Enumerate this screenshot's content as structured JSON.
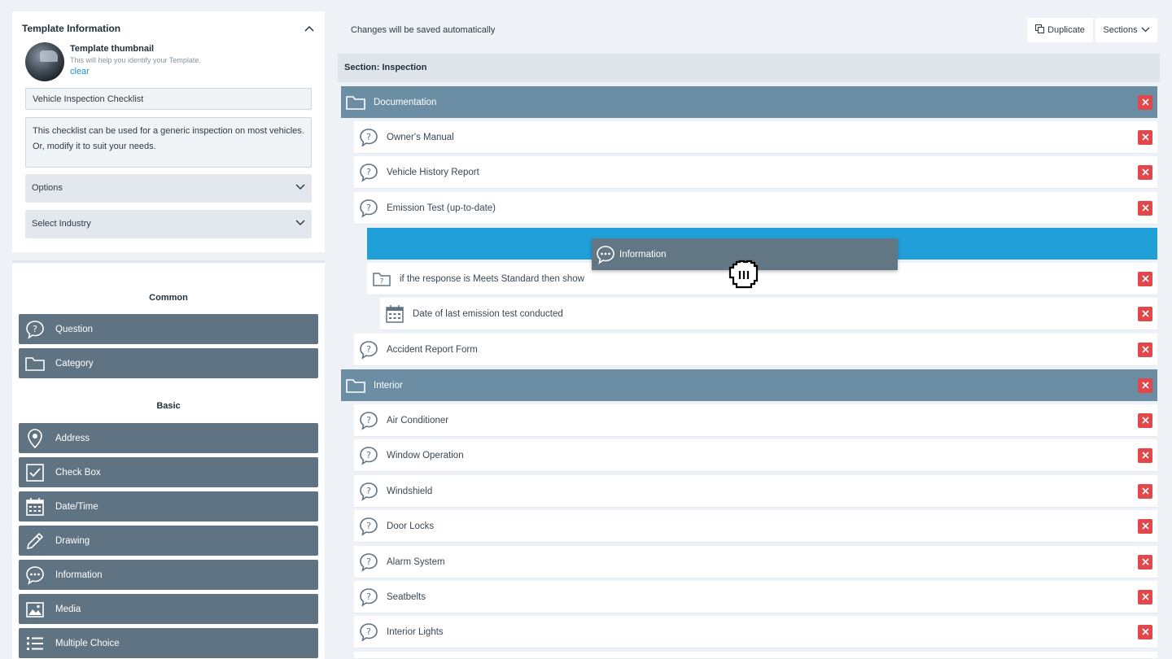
{
  "template_info": {
    "title": "Template Information",
    "thumbnail_title": "Template thumbnail",
    "thumbnail_sub": "This will help you identify your Template.",
    "clear_label": "clear",
    "name_value": "Vehicle Inspection Checklist",
    "description_value": "This checklist can be used for a generic inspection on most vehicles. Or, modify it to suit your needs.",
    "options_label": "Options",
    "industry_label": "Select Industry"
  },
  "palette": {
    "common_title": "Common",
    "common": [
      {
        "label": "Question",
        "icon": "question-bubble-icon"
      },
      {
        "label": "Category",
        "icon": "folder-icon"
      }
    ],
    "basic_title": "Basic",
    "basic": [
      {
        "label": "Address",
        "icon": "location-pin-icon"
      },
      {
        "label": "Check Box",
        "icon": "checkbox-icon"
      },
      {
        "label": "Date/Time",
        "icon": "calendar-icon"
      },
      {
        "label": "Drawing",
        "icon": "pencil-icon"
      },
      {
        "label": "Information",
        "icon": "chat-dots-icon"
      },
      {
        "label": "Media",
        "icon": "image-icon"
      },
      {
        "label": "Multiple Choice",
        "icon": "list-icon"
      }
    ]
  },
  "toolbar": {
    "autosave_text": "Changes will be saved automatically",
    "duplicate_label": "Duplicate",
    "sections_label": "Sections"
  },
  "section": {
    "title": "Section: Inspection",
    "documentation_label": "Documentation",
    "doc_items": [
      "Owner's Manual",
      "Vehicle History Report",
      "Emission Test (up-to-date)"
    ],
    "condition_label": "if the response is Meets Standard then show",
    "date_item": "Date of last emission test conducted",
    "accident_item": "Accident Report Form",
    "interior_label": "Interior",
    "interior_items": [
      "Air Conditioner",
      "Window Operation",
      "Windshield",
      "Door Locks",
      "Alarm System",
      "Seatbelts",
      "Interior Lights"
    ]
  },
  "drag": {
    "ghost_label": "Information"
  },
  "colors": {
    "category_bg": "#6b8ea5",
    "palette_bg": "#5f7383",
    "drop_zone": "#219fd9",
    "delete": "#e2474b",
    "link": "#1f8fd1"
  }
}
